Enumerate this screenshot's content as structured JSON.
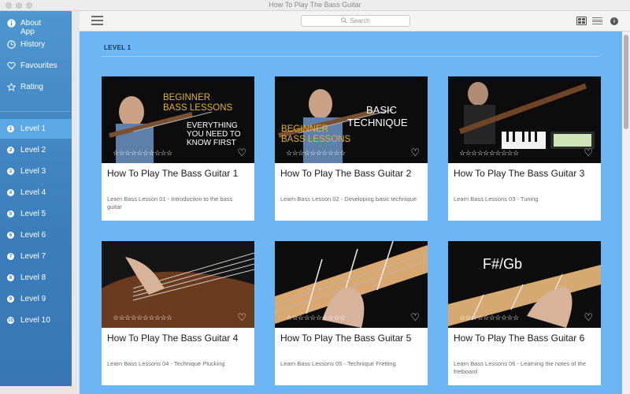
{
  "window": {
    "title": "How To Play The Bass Guitar"
  },
  "sidebar": {
    "nav": [
      {
        "label": "About App",
        "icon": "info-icon"
      },
      {
        "label": "History",
        "icon": "clock-icon"
      },
      {
        "label": "Favourites",
        "icon": "heart-icon"
      },
      {
        "label": "Rating",
        "icon": "star-icon"
      }
    ],
    "levels": [
      {
        "label": "Level 1",
        "num": "1"
      },
      {
        "label": "Level 2",
        "num": "2"
      },
      {
        "label": "Level 3",
        "num": "3"
      },
      {
        "label": "Level 4",
        "num": "4"
      },
      {
        "label": "Level 5",
        "num": "5"
      },
      {
        "label": "Level 6",
        "num": "6"
      },
      {
        "label": "Level 7",
        "num": "7"
      },
      {
        "label": "Level 8",
        "num": "8"
      },
      {
        "label": "Level 9",
        "num": "9"
      },
      {
        "label": "Level 10",
        "num": "10"
      }
    ],
    "active_level": "Level 1"
  },
  "toolbar": {
    "search_placeholder": "Search",
    "view_mode": "grid"
  },
  "main": {
    "section_title": "LEVEL 1",
    "cards": [
      {
        "title": "How To Play The Bass Guitar 1",
        "desc": "Learn Bass Lesson 01 - Introduction to the bass guitar",
        "stars": "☆☆☆☆☆☆☆☆☆☆",
        "thumb": {
          "line1": "BEGINNER",
          "line2": "BASS LESSONS",
          "line3": "EVERYTHING",
          "line4": "YOU NEED TO",
          "line5": "KNOW FIRST"
        }
      },
      {
        "title": "How To Play The Bass Guitar 2",
        "desc": "Learn Bass Lesson 02 - Developing basic technique",
        "stars": "☆☆☆☆☆☆☆☆☆☆",
        "thumb": {
          "line1": "BASIC",
          "line2": "TECHNIQUE",
          "line3": "BEGINNER",
          "line4": "BASS LESSONS"
        }
      },
      {
        "title": "How To Play The Bass Guitar 3",
        "desc": "Learn Bass Lessons 03 - Tuning",
        "stars": "☆☆☆☆☆☆☆☆☆☆"
      },
      {
        "title": "How To Play The Bass Guitar 4",
        "desc": "Learn Bass Lessons 04 - Technique Plucking",
        "stars": "☆☆☆☆☆☆☆☆☆☆"
      },
      {
        "title": "How To Play The Bass Guitar 5",
        "desc": "Learn Bass Lessons 05 - Technique Fretting",
        "stars": "☆☆☆☆☆☆☆☆☆☆"
      },
      {
        "title": "How To Play The Bass Guitar 6",
        "desc": "Learn Bass Lessons 06 - Learning the notes of the fretboard",
        "stars": "☆☆☆☆☆☆☆☆☆☆",
        "thumb": {
          "line1": "F#/Gb"
        }
      }
    ]
  },
  "colors": {
    "sidebar_top": "#4d97cf",
    "sidebar_bottom": "#3876b4",
    "active_item": "#5aa9e6",
    "content_bg": "#6db6f5",
    "thumb_title_gold": "#e2b33a",
    "thumb_title_white": "#ffffff"
  }
}
